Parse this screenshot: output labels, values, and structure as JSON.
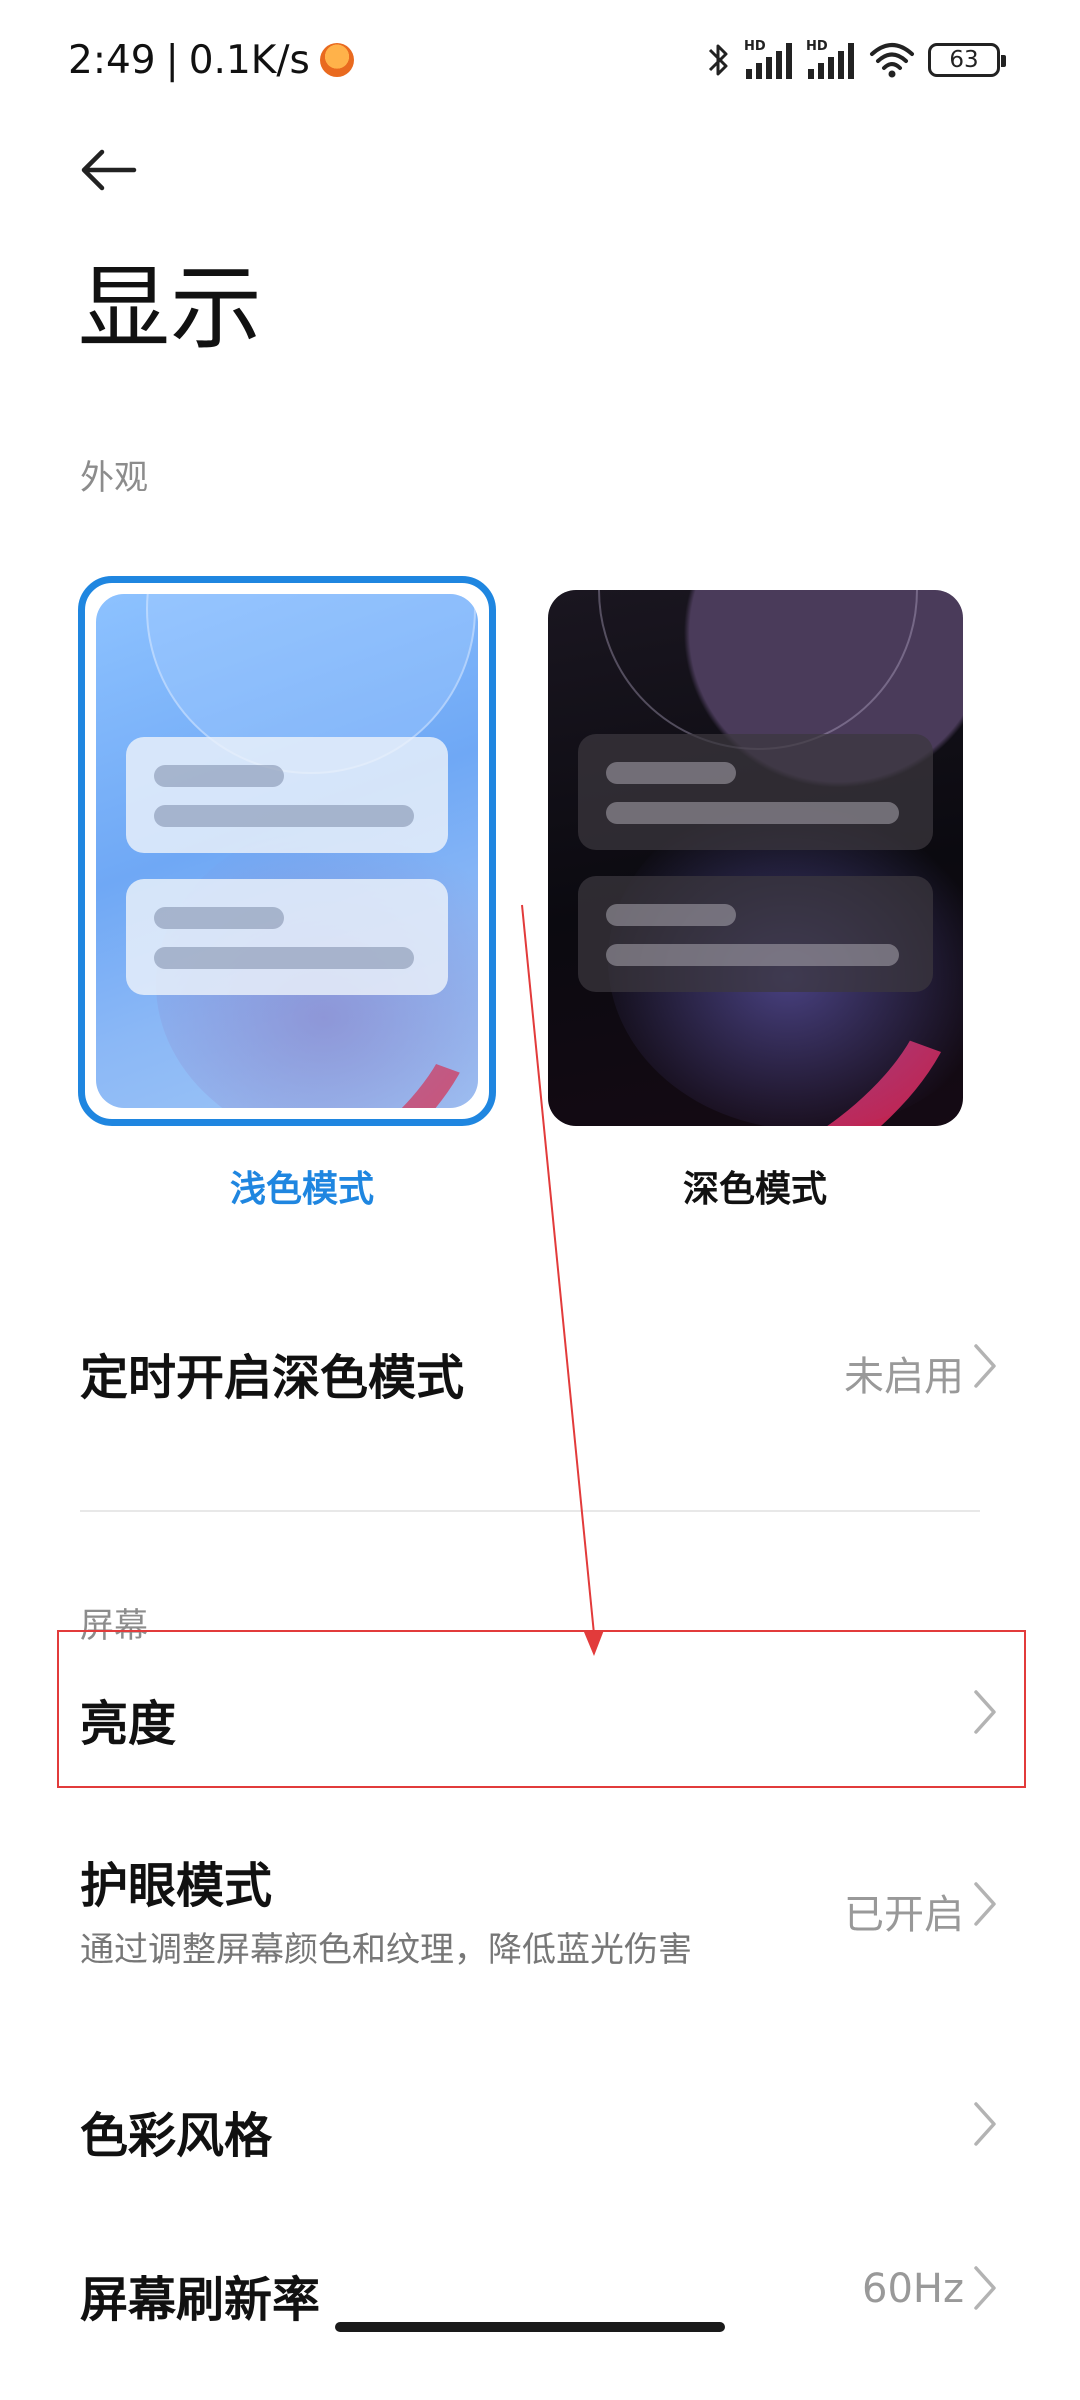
{
  "status_bar": {
    "time": "2:49",
    "separator": "|",
    "network_speed": "0.1K/s",
    "battery_level": "63",
    "signal_label_1": "HD",
    "signal_label_2": "HD"
  },
  "header": {
    "title": "显示"
  },
  "appearance": {
    "section_label": "外观",
    "light_mode_label": "浅色模式",
    "dark_mode_label": "深色模式",
    "selected": "light"
  },
  "scheduled_dark": {
    "title": "定时开启深色模式",
    "value": "未启用"
  },
  "screen": {
    "section_label": "屏幕",
    "brightness_title": "亮度",
    "eye_care_title": "护眼模式",
    "eye_care_subtitle": "通过调整屏幕颜色和纹理，降低蓝光伤害",
    "eye_care_value": "已开启",
    "color_style_title": "色彩风格",
    "refresh_rate_title": "屏幕刷新率",
    "refresh_rate_value": "60Hz"
  },
  "colors": {
    "accent": "#1f86e0",
    "annotation": "#e23b3b"
  }
}
